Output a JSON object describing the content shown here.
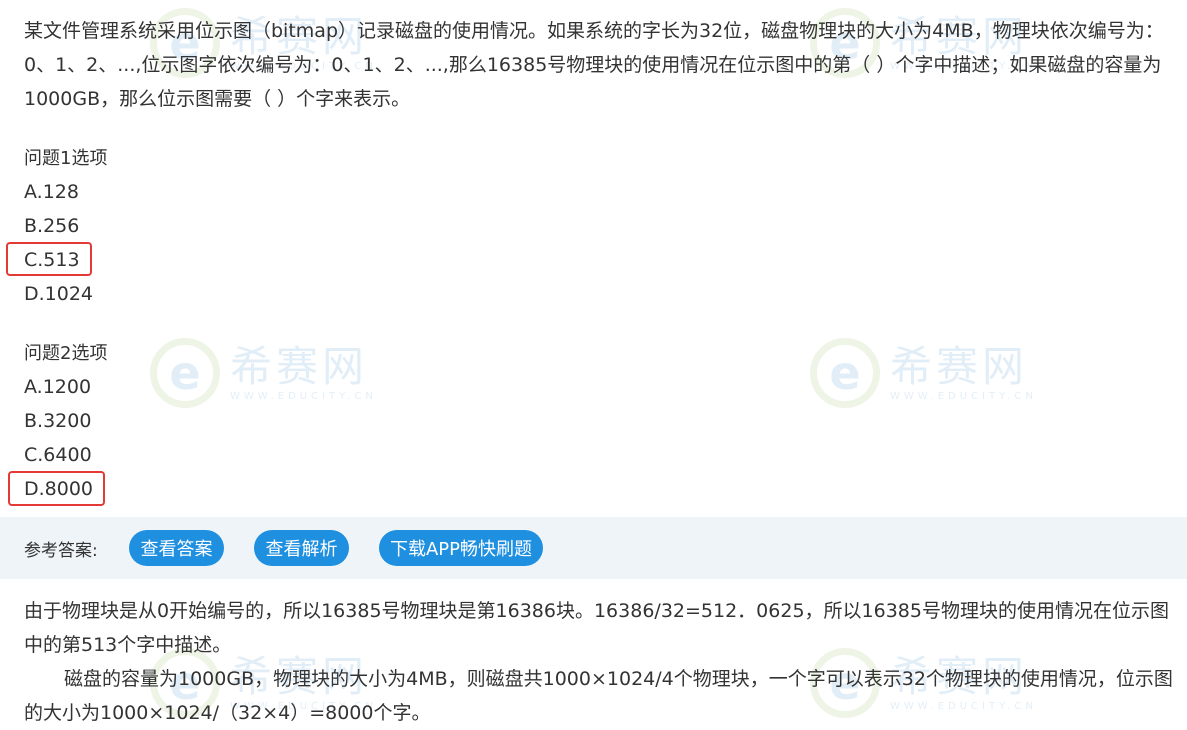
{
  "watermark": {
    "brand": "希赛网",
    "url": "WWW.EDUCITY.CN"
  },
  "question": {
    "text": "某文件管理系统采用位示图（bitmap）记录磁盘的使用情况。如果系统的字长为32位，磁盘物理块的大小为4MB，物理块依次编号为：0、1、2、...,位示图字依次编号为：0、1、2、...,那么16385号物理块的使用情况在位示图中的第（  ）个字中描述；如果磁盘的容量为1000GB，那么位示图需要（  ）个字来表示。"
  },
  "q1": {
    "heading": "问题1选项",
    "options": [
      "A.128",
      "B.256",
      "C.513",
      "D.1024"
    ],
    "highlighted": "C.513"
  },
  "q2": {
    "heading": "问题2选项",
    "options": [
      "A.1200",
      "B.3200",
      "C.6400",
      "D.8000"
    ],
    "highlighted": "D.8000"
  },
  "answer_bar": {
    "label": "参考答案:",
    "buttons": [
      "查看答案",
      "查看解析",
      "下载APP畅快刷题"
    ]
  },
  "explanation": {
    "para1": "由于物理块是从0开始编号的，所以16385号物理块是第16386块。16386/32=512．0625，所以16385号物理块的使用情况在位示图中的第513个字中描述。",
    "para2": "磁盘的容量为1000GB，物理块的大小为4MB，则磁盘共1000×1024/4个物理块，一个字可以表示32个物理块的使用情况，位示图的大小为1000×1024/（32×4）=8000个字。"
  },
  "colors": {
    "accent": "#1f8fe0",
    "highlight": "#e53935",
    "bar_bg": "#eef4f8"
  }
}
